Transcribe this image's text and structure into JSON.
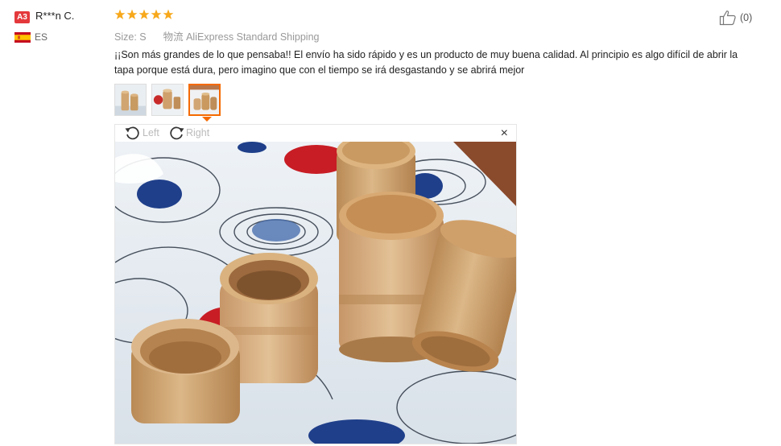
{
  "user": {
    "level_badge": "A3",
    "name": "R***n C.",
    "country": "ES",
    "flag_icon": "spain-flag-icon"
  },
  "review": {
    "rating": 5,
    "rating_max": 5,
    "size_label": "Size:",
    "size_value": "S",
    "shipping_label": "物流",
    "shipping_value": "AliExpress Standard Shipping",
    "text": "¡¡Son más grandes de lo que pensaba!! El envío ha sido rápido y es un producto de muy buena calidad. Al principio es algo difícil de abrir la tapa porque está dura, pero imagino que con el tiempo se irá desgastando y se abrirá mejor",
    "helpful_count": "(0)",
    "thumbnail_count": 3,
    "selected_thumbnail": 3
  },
  "viewer": {
    "rotate_left_label": "Left",
    "rotate_right_label": "Right",
    "close_label": "×"
  },
  "colors": {
    "star": "#f7a81b",
    "badge": "#e4393c",
    "selection": "#f56a00",
    "muted_text": "#999999"
  }
}
